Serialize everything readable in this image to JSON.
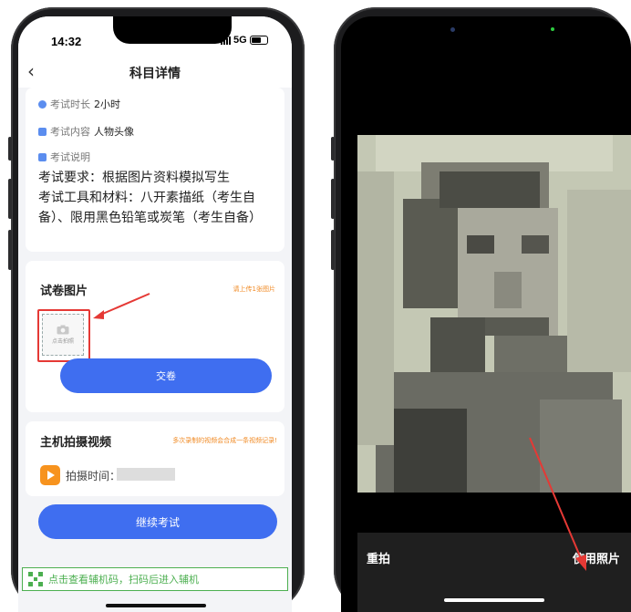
{
  "left_screen": {
    "status": {
      "time": "14:32",
      "network": "5G"
    },
    "nav": {
      "back_icon": "chevron-left-icon",
      "title": "科目详情"
    },
    "exam_info": {
      "duration_label": "考试时长",
      "duration_value": "2小时",
      "content_label": "考试内容",
      "content_value": "人物头像",
      "description_label": "考试说明",
      "description_text": "考试要求：根据图片资料模拟写生\n考试工具和材料：八开素描纸（考生自备）、限用黑色铅笔或炭笔（考生自备）"
    },
    "paper_section": {
      "title": "试卷图片",
      "hint": "请上传1张图片",
      "photo_button_label": "点击拍照",
      "submit_label": "交卷"
    },
    "video_section": {
      "title": "主机拍摄视频",
      "hint": "多次录制的视频会合成一条视频记录!",
      "shoot_time_label": "拍摄时间："
    },
    "continue_label": "继续考试",
    "aux_bar_text": "点击查看辅机码，扫码后进入辅机",
    "colors": {
      "accent": "#3f6ef0",
      "warning": "#f08a24",
      "highlight": "#e53935",
      "green": "#4caf50"
    }
  },
  "right_screen": {
    "retake_label": "重拍",
    "use_photo_label": "使用照片"
  }
}
